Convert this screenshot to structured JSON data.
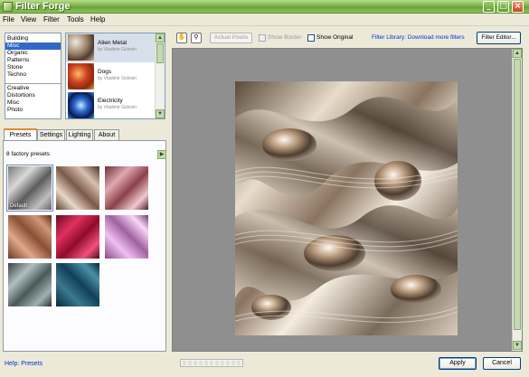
{
  "window": {
    "title": "Filter Forge"
  },
  "menu": [
    "File",
    "View",
    "Filter",
    "Tools",
    "Help"
  ],
  "categories": {
    "group1": [
      "Building",
      "Misc",
      "Organic",
      "Patterns",
      "Stone",
      "Techno"
    ],
    "group2": [
      "Creative",
      "Distortions",
      "Misc",
      "Photo"
    ],
    "selected": "Misc"
  },
  "filters": [
    {
      "name": "Alien Metal",
      "author": "by Vladimir Golovin"
    },
    {
      "name": "Dogs",
      "author": "by Vladimir Golovin"
    },
    {
      "name": "Electricity",
      "author": "by Vladimir Golovin"
    }
  ],
  "tabs": [
    "Presets",
    "Settings",
    "Lighting",
    "About"
  ],
  "presets": {
    "count_label": "8 factory presets",
    "default_label": "Default"
  },
  "toolbar": {
    "hand_icon": "hand-icon",
    "zoom_icon": "zoom-icon",
    "actual_pixels": "Actual Pixels",
    "show_border": "Show Border",
    "show_original": "Show Original",
    "library_link": "Filter Library: Download more filters",
    "filter_editor": "Filter Editor..."
  },
  "footer": {
    "help": "Help: Presets",
    "apply": "Apply",
    "cancel": "Cancel"
  },
  "colors": {
    "titlebar": "#7db24a",
    "link": "#0033cc",
    "preview_bg": "#8f8f8f"
  }
}
